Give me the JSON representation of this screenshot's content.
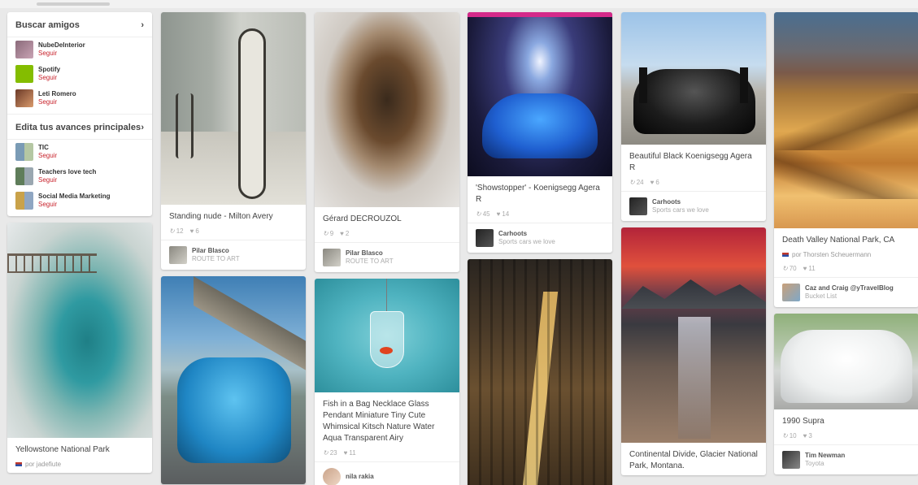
{
  "sidebar": {
    "find_friends": {
      "title": "Buscar amigos",
      "items": [
        {
          "name": "NubeDeInterior",
          "action": "Seguir"
        },
        {
          "name": "Spotify",
          "action": "Seguir"
        },
        {
          "name": "Leti Romero",
          "action": "Seguir"
        }
      ]
    },
    "top_boards": {
      "title": "Edita tus avances principales",
      "items": [
        {
          "name": "TIC",
          "action": "Seguir"
        },
        {
          "name": "Teachers love tech",
          "action": "Seguir"
        },
        {
          "name": "Social Media Marketing",
          "action": "Seguir"
        }
      ]
    }
  },
  "pins": {
    "yellowstone": {
      "desc": "Yellowstone National Park",
      "via": "por jadefiute"
    },
    "nude": {
      "desc": "Standing nude - Milton Avery",
      "repins": "12",
      "likes": "6",
      "user": "Pilar Blasco",
      "board": "ROUTE TO ART"
    },
    "bmw": {},
    "gerard": {
      "desc": "Gérard DECROUZOL",
      "repins": "9",
      "likes": "2",
      "user": "Pilar Blasco",
      "board": "ROUTE TO ART"
    },
    "fish": {
      "desc": "Fish in a Bag Necklace Glass Pendant Miniature Tiny Cute Whimsical Kitsch Nature Water Aqua Transparent Airy",
      "repins": "23",
      "likes": "11",
      "user": "nila rakia"
    },
    "showstopper": {
      "desc": "'Showstopper' - Koenigsegg Agera R",
      "repins": "45",
      "likes": "14",
      "user": "Carhoots",
      "board": "Sports cars we love"
    },
    "city": {},
    "black_agera": {
      "desc": "Beautiful Black Koenigsegg Agera R",
      "repins": "24",
      "likes": "6",
      "user": "Carhoots",
      "board": "Sports cars we love"
    },
    "divide": {
      "desc": "Continental Divide, Glacier National Park, Montana."
    },
    "death_valley": {
      "desc": "Death Valley National Park, CA",
      "via": "por Thorsten Scheuermann",
      "repins": "70",
      "likes": "11",
      "user": "Caz and Craig @yTravelBlog",
      "board": "Bucket List"
    },
    "supra": {
      "desc": "1990 Supra",
      "repins": "10",
      "likes": "3",
      "user": "Tim Newman",
      "board": "Toyota"
    }
  },
  "colors": {
    "accent": "#c8232c",
    "background": "#e9e9e9",
    "card": "#ffffff"
  }
}
